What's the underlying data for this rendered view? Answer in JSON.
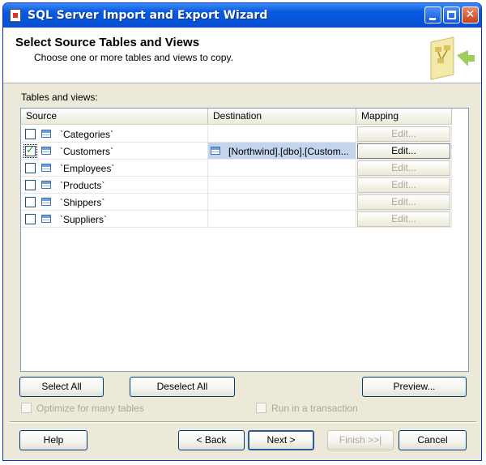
{
  "window": {
    "title": "SQL Server Import and Export Wizard"
  },
  "header": {
    "heading": "Select Source Tables and Views",
    "subheading": "Choose one or more tables and views to copy."
  },
  "grid": {
    "label": "Tables and views:",
    "columns": {
      "source": "Source",
      "destination": "Destination",
      "mapping": "Mapping"
    },
    "rows": [
      {
        "checked": false,
        "source": "`Categories`",
        "destination": "",
        "mapping": "Edit...",
        "mapping_enabled": false
      },
      {
        "checked": true,
        "source": "`Customers`",
        "destination": "[Northwind].[dbo].[Custom...",
        "mapping": "Edit...",
        "mapping_enabled": true
      },
      {
        "checked": false,
        "source": "`Employees`",
        "destination": "",
        "mapping": "Edit...",
        "mapping_enabled": false
      },
      {
        "checked": false,
        "source": "`Products`",
        "destination": "",
        "mapping": "Edit...",
        "mapping_enabled": false
      },
      {
        "checked": false,
        "source": "`Shippers`",
        "destination": "",
        "mapping": "Edit...",
        "mapping_enabled": false
      },
      {
        "checked": false,
        "source": "`Suppliers`",
        "destination": "",
        "mapping": "Edit...",
        "mapping_enabled": false
      }
    ]
  },
  "actions": {
    "select_all": "Select All",
    "deselect_all": "Deselect All",
    "preview": "Preview...",
    "optimize": "Optimize for many tables",
    "optimize_checked": false,
    "transaction": "Run in a transaction",
    "transaction_checked": false
  },
  "footer": {
    "help": "Help",
    "back": "< Back",
    "next": "Next >",
    "finish": "Finish >>|",
    "cancel": "Cancel"
  },
  "colors": {
    "titlebar": "#0a5ae0",
    "dialog": "#ece9d8",
    "selection": "#c4d4ec",
    "check": "#21a121"
  }
}
